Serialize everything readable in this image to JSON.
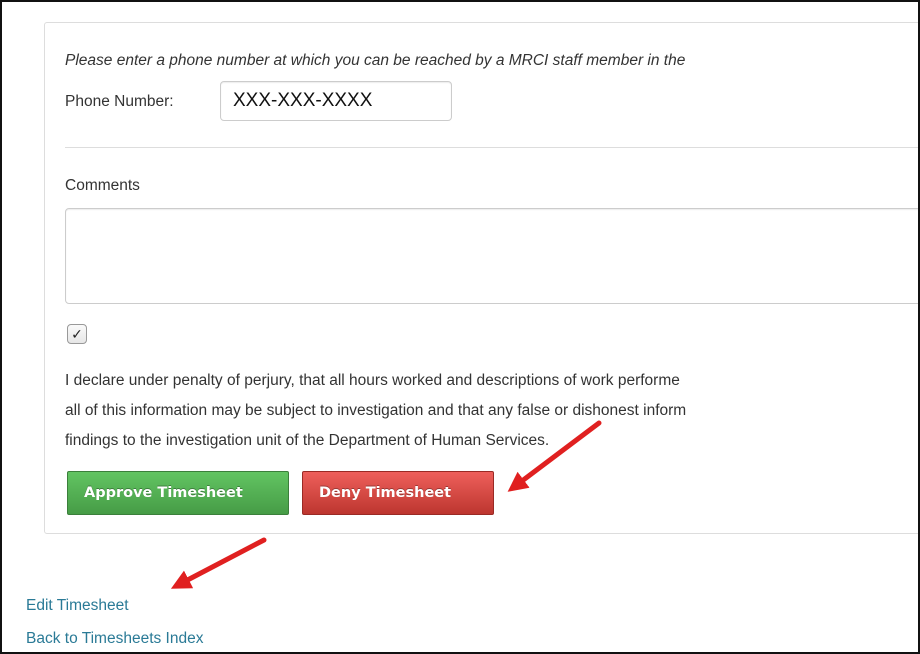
{
  "form": {
    "instruction": "Please enter a phone number at which you can be reached by a MRCI staff member in the",
    "phone_label": "Phone Number:",
    "phone_value": "XXX-XXX-XXXX",
    "comments_label": "Comments",
    "checkbox_glyph": "✓",
    "declaration_lines": [
      "I declare under penalty of perjury, that all hours worked and descriptions of work performe",
      "all of this information may be subject to investigation and that any false or dishonest inform",
      "findings to the investigation unit of the Department of Human Services."
    ],
    "approve_label": "Approve Timesheet",
    "deny_label": "Deny Timesheet"
  },
  "links": {
    "edit": "Edit Timesheet",
    "back": "Back to Timesheets Index"
  },
  "colors": {
    "approve": "#5bb75b",
    "deny": "#da4f49",
    "link": "#2a7a96",
    "annotation_arrow": "#e02020"
  }
}
